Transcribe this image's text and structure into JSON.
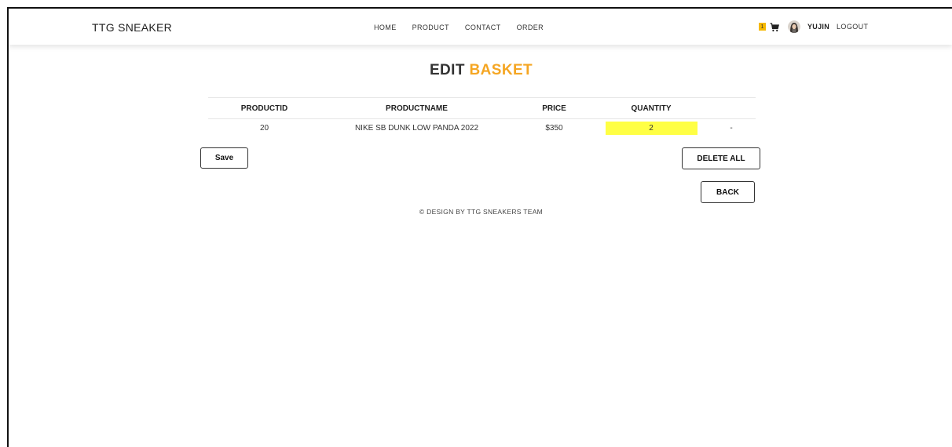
{
  "header": {
    "brand": "TTG SNEAKER",
    "nav": [
      {
        "label": "HOME"
      },
      {
        "label": "PRODUCT"
      },
      {
        "label": "CONTACT"
      },
      {
        "label": "ORDER"
      }
    ],
    "cart_count": "1",
    "user_name": "YUJIN",
    "logout_label": "LOGOUT",
    "cart_icon": "cart-icon",
    "avatar_icon": "avatar"
  },
  "page": {
    "title_prefix": "EDIT",
    "title_accent": "BASKET"
  },
  "table": {
    "columns": [
      "PRODUCTID",
      "PRODUCTNAME",
      "PRICE",
      "QUANTITY",
      ""
    ],
    "rows": [
      {
        "product_id": "20",
        "product_name": "NIKE SB DUNK LOW PANDA 2022",
        "price": "$350",
        "quantity": "2",
        "remove": "-"
      }
    ]
  },
  "actions": {
    "save_label": "Save",
    "delete_all_label": "DELETE ALL",
    "back_label": "BACK"
  },
  "footer": {
    "text": "© DESIGN BY TTG SNEAKERS TEAM"
  },
  "colors": {
    "accent": "#f5a623",
    "badge": "#f5b800",
    "quantity_highlight": "#ffff44"
  }
}
